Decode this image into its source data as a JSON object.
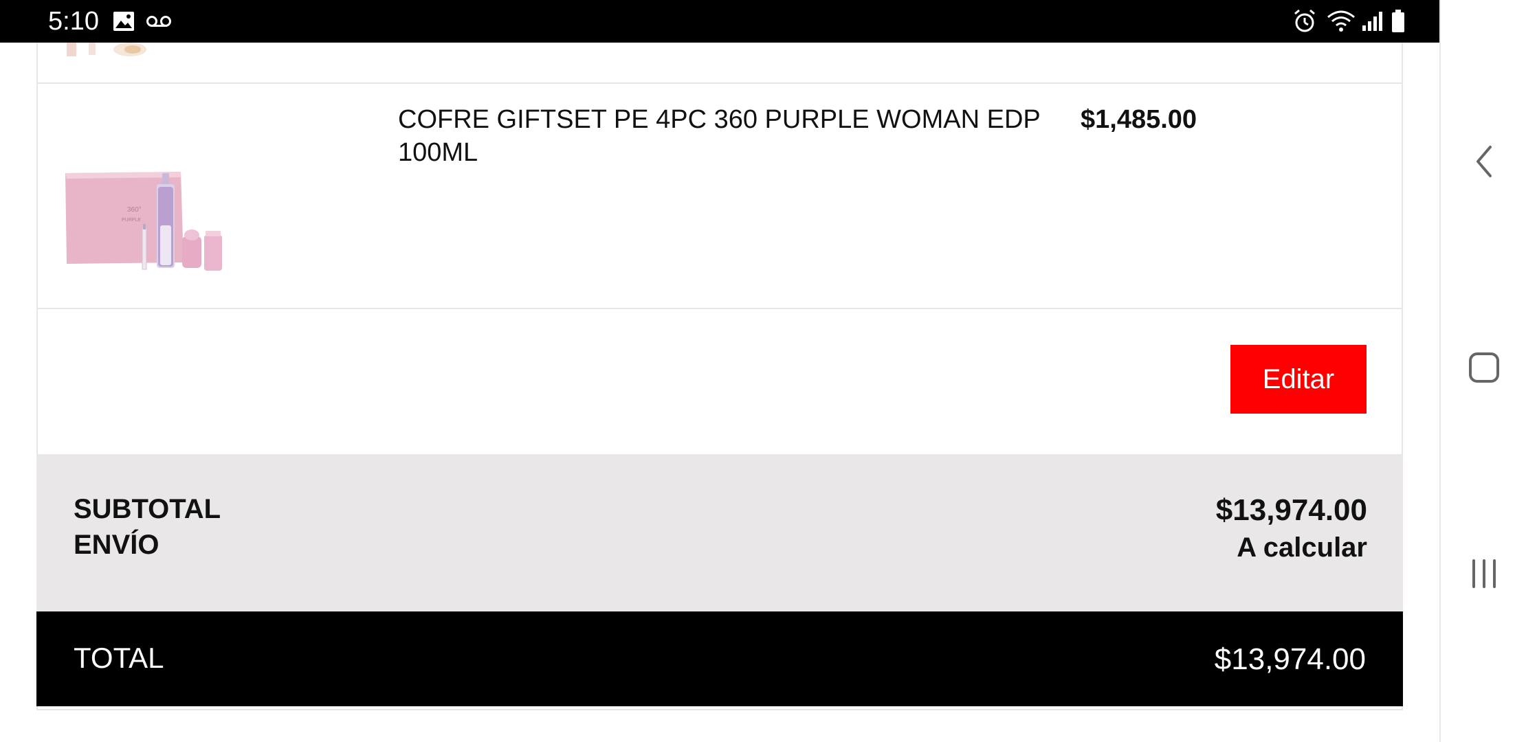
{
  "status_bar": {
    "time": "5:10",
    "left_icons": [
      "image-icon",
      "voicemail-icon"
    ],
    "right_icons": [
      "alarm-icon",
      "wifi-icon",
      "signal-icon",
      "battery-icon"
    ]
  },
  "cart_item": {
    "name": "COFRE GIFTSET PE 4PC 360 PURPLE WOMAN EDP 100ML",
    "price": "$1,485.00"
  },
  "actions": {
    "edit_label": "Editar"
  },
  "summary": {
    "subtotal_label": "SUBTOTAL",
    "subtotal_value": "$13,974.00",
    "shipping_label": "ENVÍO",
    "shipping_value": "A calcular"
  },
  "total": {
    "label": "TOTAL",
    "value": "$13,974.00"
  },
  "navigation": {
    "buttons": [
      "back-icon",
      "home-icon",
      "recents-icon"
    ]
  },
  "colors": {
    "accent": "#ff0000",
    "summary_bg": "#eae7e8",
    "total_bg": "#000000"
  }
}
